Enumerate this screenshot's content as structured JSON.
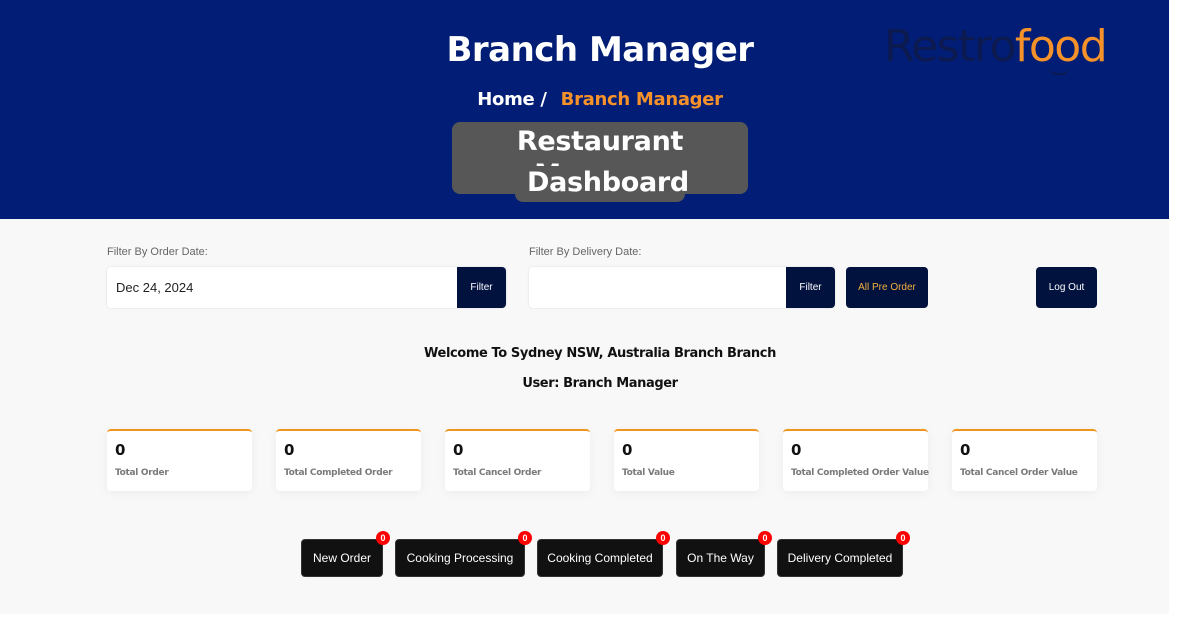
{
  "header": {
    "title": "Branch Manager",
    "breadcrumb": {
      "home": "Home",
      "separator": "/",
      "current": "Branch Manager"
    },
    "dashboard_title_line1": "Restaurant Manager",
    "dashboard_title_line2": "Dashboard",
    "logo": {
      "part1": "Restro",
      "part2": "food"
    },
    "colors": {
      "banner": "#011d75",
      "accent": "#f7922a"
    }
  },
  "filters": {
    "order_date": {
      "label": "Filter By Order Date:",
      "value": "Dec 24, 2024",
      "button": "Filter"
    },
    "delivery_date": {
      "label": "Filter By Delivery Date:",
      "value": "",
      "button": "Filter"
    },
    "all_pre_order": "All Pre Order",
    "log_out": "Log Out"
  },
  "welcome": {
    "line1": "Welcome To Sydney NSW, Australia Branch Branch",
    "line2": "User: Branch Manager"
  },
  "stats": [
    {
      "value": "0",
      "label": "Total Order"
    },
    {
      "value": "0",
      "label": "Total Completed Order"
    },
    {
      "value": "0",
      "label": "Total Cancel Order"
    },
    {
      "value": "0",
      "label": "Total Value"
    },
    {
      "value": "0",
      "label": "Total Completed Order Value"
    },
    {
      "value": "0",
      "label": "Total Cancel Order Value"
    }
  ],
  "order_status": [
    {
      "label": "New Order",
      "count": "0"
    },
    {
      "label": "Cooking Processing",
      "count": "0"
    },
    {
      "label": "Cooking Completed",
      "count": "0"
    },
    {
      "label": "On The Way",
      "count": "0"
    },
    {
      "label": "Delivery Completed",
      "count": "0"
    }
  ]
}
